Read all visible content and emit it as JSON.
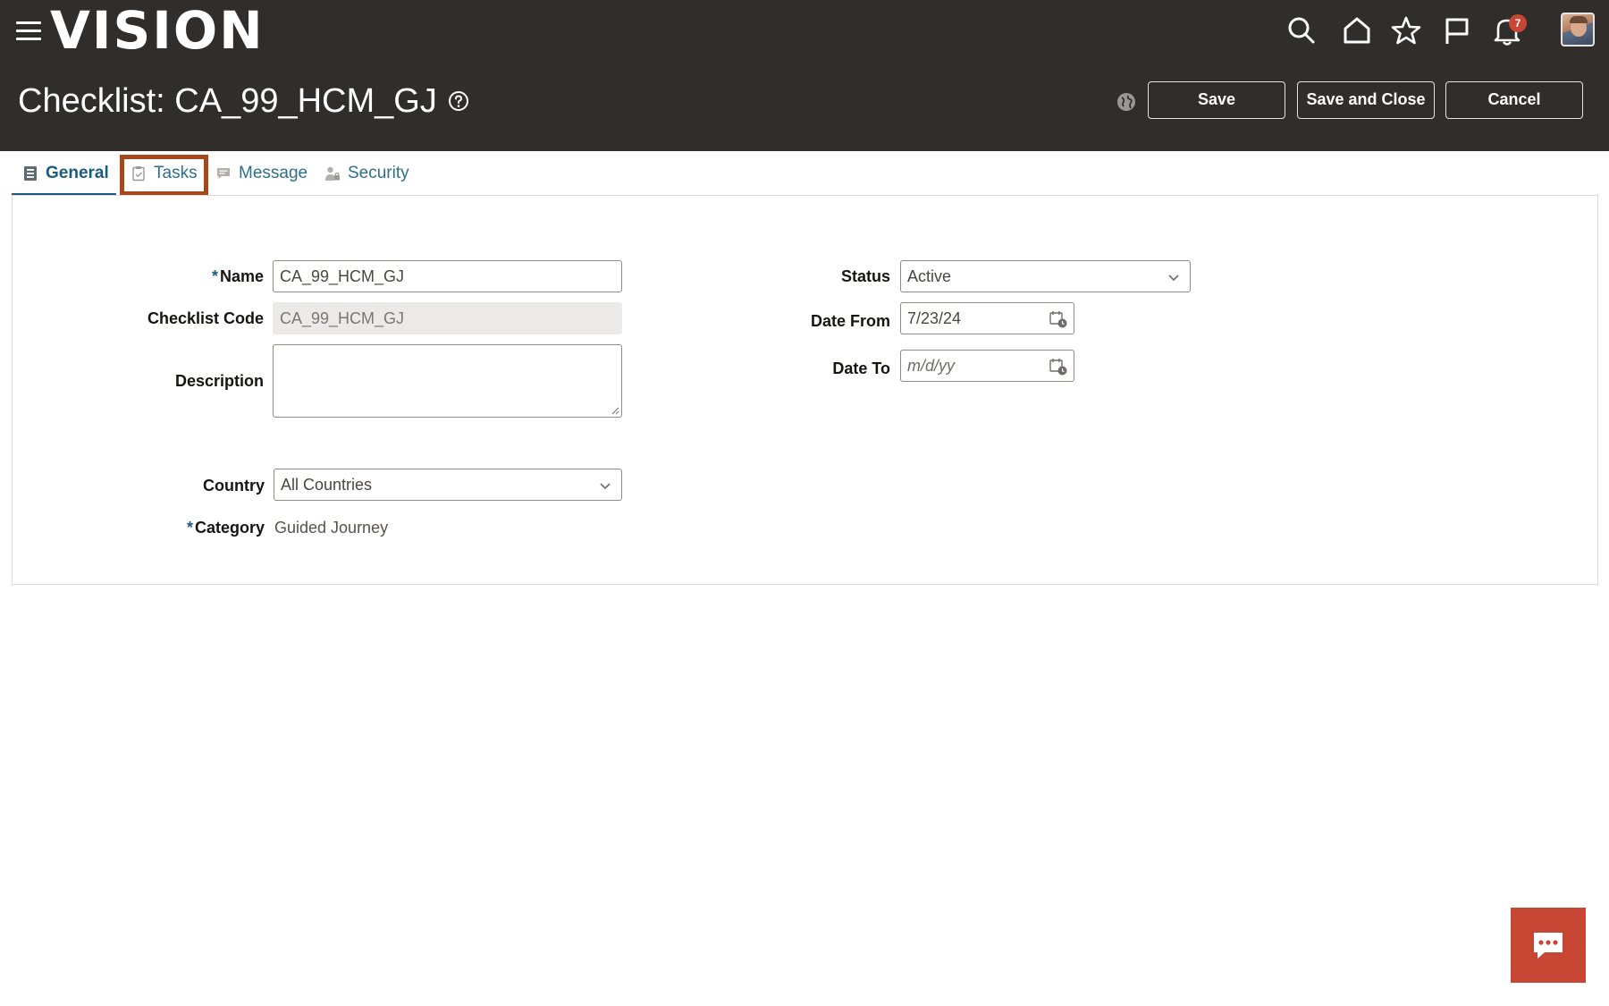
{
  "header": {
    "logo": "VISION",
    "notifications_count": "7",
    "icons": [
      "menu-icon",
      "search-icon",
      "home-icon",
      "star-icon",
      "flag-icon",
      "bell-icon"
    ],
    "colors": {
      "header_bg": "#312d2a",
      "accent": "#c74634",
      "tab_active": "#1b5b80",
      "highlight": "#a7471c"
    }
  },
  "page": {
    "title": "Checklist: CA_99_HCM_GJ",
    "buttons": {
      "save": "Save",
      "save_close": "Save and Close",
      "cancel": "Cancel"
    }
  },
  "tabs": [
    {
      "label": "General",
      "icon": "form-icon"
    },
    {
      "label": "Tasks",
      "icon": "clipboard-icon"
    },
    {
      "label": "Message",
      "icon": "message-icon"
    },
    {
      "label": "Security",
      "icon": "user-lock-icon"
    }
  ],
  "form": {
    "required_mark": "*",
    "name": {
      "label": "Name",
      "value": "CA_99_HCM_GJ"
    },
    "checklist_code": {
      "label": "Checklist Code",
      "value": "CA_99_HCM_GJ"
    },
    "description": {
      "label": "Description",
      "value": ""
    },
    "country": {
      "label": "Country",
      "value": "All Countries"
    },
    "category": {
      "label": "Category",
      "value": "Guided Journey"
    },
    "status": {
      "label": "Status",
      "value": "Active"
    },
    "date_from": {
      "label": "Date From",
      "value": "7/23/24"
    },
    "date_to": {
      "label": "Date To",
      "placeholder": "m/d/yy"
    }
  }
}
